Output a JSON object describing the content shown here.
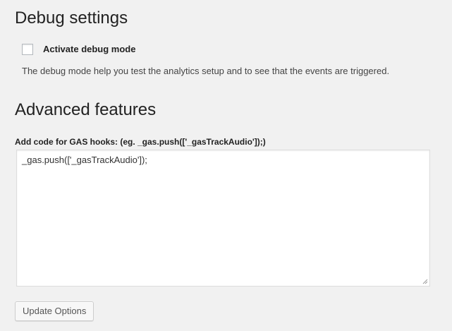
{
  "debug_section": {
    "title": "Debug settings",
    "checkbox_label": "Activate debug mode",
    "checked": false,
    "description": "The debug mode help you test the analytics setup and to see that the events are triggered."
  },
  "advanced_section": {
    "title": "Advanced features",
    "hooks_label": "Add code for GAS hooks: (eg. _gas.push(['_gasTrackAudio']);)",
    "hooks_value": "_gas.push(['_gasTrackAudio']);"
  },
  "actions": {
    "update_label": "Update Options"
  },
  "colors": {
    "background": "#f1f1f1",
    "textarea_border": "#dddddd",
    "button_background": "#f7f7f7"
  }
}
